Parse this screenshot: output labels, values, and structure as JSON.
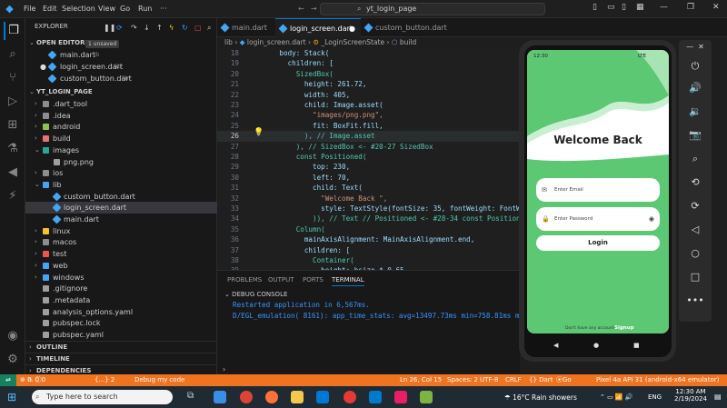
{
  "menu": [
    "File",
    "Edit",
    "Selection",
    "View",
    "Go",
    "Run"
  ],
  "window_title": "yt_login_page",
  "explorer": {
    "title": "EXPLORER",
    "open_editors_label": "OPEN EDITORS",
    "unsaved_badge": "1 unsaved",
    "open_editors": [
      {
        "name": "main.dart",
        "dir": "lib"
      },
      {
        "name": "login_screen.dart",
        "dir": "lib"
      },
      {
        "name": "custom_button.dart",
        "dir": "lib"
      }
    ],
    "project_label": "YT_LOGIN_PAGE",
    "tree": [
      {
        "name": ".dart_tool",
        "type": "folder",
        "depth": 1
      },
      {
        "name": ".idea",
        "type": "folder",
        "depth": 1
      },
      {
        "name": "android",
        "type": "folder",
        "depth": 1
      },
      {
        "name": "build",
        "type": "folder",
        "depth": 1
      },
      {
        "name": "images",
        "type": "folder",
        "depth": 1,
        "open": true
      },
      {
        "name": "png.png",
        "type": "file",
        "depth": 2
      },
      {
        "name": "ios",
        "type": "folder",
        "depth": 1
      },
      {
        "name": "lib",
        "type": "folder",
        "depth": 1,
        "open": true
      },
      {
        "name": "custom_button.dart",
        "type": "dart",
        "depth": 2
      },
      {
        "name": "login_screen.dart",
        "type": "dart",
        "depth": 2
      },
      {
        "name": "main.dart",
        "type": "dart",
        "depth": 2
      },
      {
        "name": "linux",
        "type": "folder",
        "depth": 1
      },
      {
        "name": "macos",
        "type": "folder",
        "depth": 1
      },
      {
        "name": "test",
        "type": "folder",
        "depth": 1
      },
      {
        "name": "web",
        "type": "folder",
        "depth": 1
      },
      {
        "name": "windows",
        "type": "folder",
        "depth": 1
      },
      {
        "name": ".gitignore",
        "type": "file",
        "depth": 1
      },
      {
        "name": ".metadata",
        "type": "file",
        "depth": 1
      },
      {
        "name": "analysis_options.yaml",
        "type": "file",
        "depth": 1
      },
      {
        "name": "pubspec.lock",
        "type": "file",
        "depth": 1
      },
      {
        "name": "pubspec.yaml",
        "type": "file",
        "depth": 1
      }
    ],
    "outline": "OUTLINE",
    "timeline": "TIMELINE",
    "dependencies": "DEPENDENCIES"
  },
  "tabs": [
    "main.dart",
    "login_screen.dart",
    "custom_button.dart"
  ],
  "breadcrumb": {
    "a": "lib",
    "b": "login_screen.dart",
    "c": "_LoginScreenState",
    "d": "build"
  },
  "code_lines": [
    {
      "n": "18",
      "t": "      body: Stack("
    },
    {
      "n": "19",
      "t": "        children: ["
    },
    {
      "n": "20",
      "t": "          SizedBox("
    },
    {
      "n": "21",
      "t": "            height: 261.72,"
    },
    {
      "n": "22",
      "t": "            width: 405,"
    },
    {
      "n": "23",
      "t": "            child: Image.asset("
    },
    {
      "n": "24",
      "t": "              \"images/png.png\","
    },
    {
      "n": "25",
      "t": "              fit: BoxFit.fill,"
    },
    {
      "n": "26",
      "t": "            ), // Image.asset"
    },
    {
      "n": "27",
      "t": "          ), // SizedBox <- #20-27 SizedBox"
    },
    {
      "n": "28",
      "t": "          const Positioned("
    },
    {
      "n": "29",
      "t": "              top: 230,"
    },
    {
      "n": "30",
      "t": "              left: 70,"
    },
    {
      "n": "31",
      "t": "              child: Text("
    },
    {
      "n": "32",
      "t": "                \"Welcome Back \","
    },
    {
      "n": "33",
      "t": "                style: TextStyle(fontSize: 35, fontWeight: FontWe"
    },
    {
      "n": "34",
      "t": "              )), // Text // Positioned <- #28-34 const Position"
    },
    {
      "n": "35",
      "t": "          Column("
    },
    {
      "n": "36",
      "t": "            mainAxisAlignment: MainAxisAlignment.end,"
    },
    {
      "n": "37",
      "t": "            children: ["
    },
    {
      "n": "38",
      "t": "              Container("
    },
    {
      "n": "39",
      "t": "                height: hsize * 0.65,"
    }
  ],
  "panel": {
    "tabs": [
      "PROBLEMS",
      "OUTPUT",
      "PORTS",
      "TERMINAL"
    ],
    "debug_console": "DEBUG CONSOLE",
    "lines": [
      "Restarted application in 6,567ms.",
      "D/EGL_emulation( 8161): app_time_stats: avg=13497.73ms min=758.81ms ma"
    ]
  },
  "status": {
    "errors": "0",
    "warnings": "0",
    "info": "0",
    "braces": "{...} 2",
    "debug": "Debug my code",
    "position": "Ln 26, Col 15",
    "spaces": "Spaces: 2",
    "encoding": "UTF-8",
    "eol": "CRLF",
    "lang": "{} Dart",
    "golive": "Go Live",
    "device": "Pixel 4a API 31 (android-x64 emulator)"
  },
  "taskbar": {
    "search_placeholder": "Type here to search",
    "weather": "16°C  Rain showers",
    "lang": "ENG",
    "time": "12:30 AM",
    "date": "2/19/2024"
  },
  "phone": {
    "clock": "12:30",
    "network": "LTE",
    "title": "Welcome Back",
    "email_placeholder": "Enter Email",
    "password_placeholder": "Enter Password",
    "login_label": "Login",
    "no_account": "Don't have any account?",
    "signup": "Signup",
    "accent": "#5dc873"
  }
}
